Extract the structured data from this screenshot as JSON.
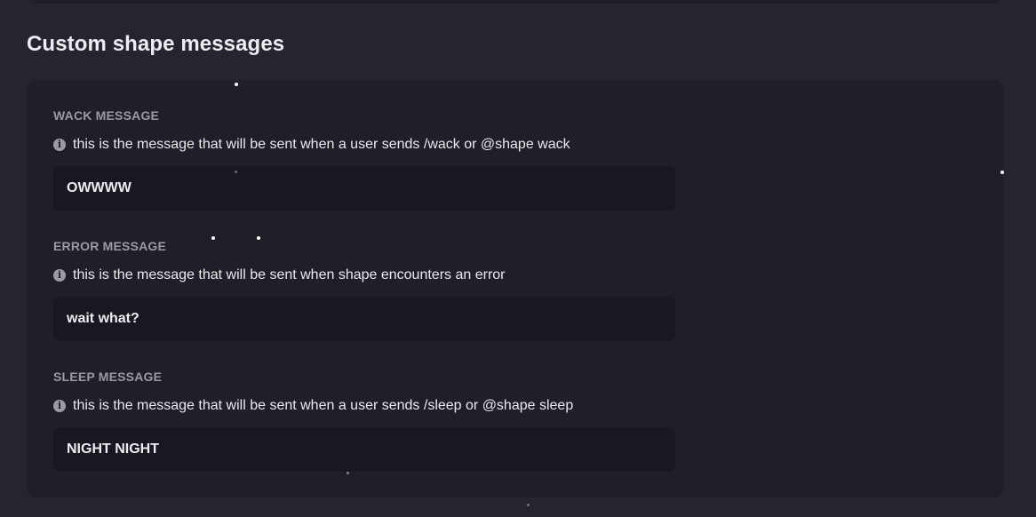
{
  "section": {
    "title": "Custom shape messages"
  },
  "fields": [
    {
      "label": "WACK MESSAGE",
      "help": "this is the message that will be sent when a user sends /wack or @shape wack",
      "value": "OWWWW",
      "help_icon": "info-icon"
    },
    {
      "label": "ERROR MESSAGE",
      "help": "this is the message that will be sent when shape encounters an error",
      "value": "wait what?",
      "help_icon": "info-icon"
    },
    {
      "label": "SLEEP MESSAGE",
      "help": "this is the message that will be sent when a user sends /sleep or @shape sleep",
      "value": "NIGHT NIGHT",
      "help_icon": "info-icon"
    }
  ],
  "colors": {
    "background": "#25252f",
    "panel": "#1f1f28",
    "input": "#181820",
    "label": "#9a9aa6",
    "text": "#e9e9ee"
  }
}
